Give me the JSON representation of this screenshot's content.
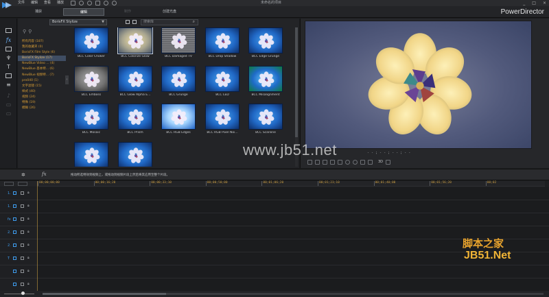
{
  "app": {
    "menu": [
      "文件",
      "编辑",
      "查看",
      "播放"
    ],
    "project_name": "未命名的项目",
    "window_controls": [
      "_",
      "□",
      "×"
    ],
    "brand": "PowerDirector",
    "modes": [
      "捕获",
      "编辑",
      "制作",
      "创建光盘"
    ]
  },
  "library": {
    "dropdown_value": "BorisFX Stylize",
    "search_placeholder": "搜索库",
    "categories": [
      "所有内容 (187)",
      "我的收藏夹 (0)",
      "BorisFX Film Style (6)",
      "BorisFX Stylize (17)",
      "NewBlue Video ... (4)",
      "NewBlue 基本特... (6)",
      "NewBlue 视频特... (7)",
      "pro040 (1)",
      "文字滤镜 (15)",
      "样式 (40)",
      "视频 (24)",
      "特殊 (19)",
      "模糊 (26)"
    ],
    "effects": [
      {
        "label": "BCC Color Choker",
        "style": "blue"
      },
      {
        "label": "BCC Colorize Glow",
        "style": "pale"
      },
      {
        "label": "BCC Damaged TV",
        "style": "glitch"
      },
      {
        "label": "BCC Drop Shadow",
        "style": "blue"
      },
      {
        "label": "BCC Edge Grunge",
        "style": "blue"
      },
      {
        "label": "BCC Emboss",
        "style": "gray"
      },
      {
        "label": "BCC Glow Alpha E...",
        "style": "blue"
      },
      {
        "label": "BCC Grunge",
        "style": "blue"
      },
      {
        "label": "BCC LED",
        "style": "blue"
      },
      {
        "label": "BCC Misalignment",
        "style": "green"
      },
      {
        "label": "BCC Mosaic",
        "style": "blue"
      },
      {
        "label": "BCC Prism",
        "style": "blue"
      },
      {
        "label": "BCC RGB Edges",
        "style": "bright"
      },
      {
        "label": "BCC RGB Pixel Noi...",
        "style": "blue"
      },
      {
        "label": "BCC Scanline",
        "style": "blue"
      },
      {
        "label": "",
        "style": "blue"
      },
      {
        "label": "",
        "style": "blue"
      }
    ]
  },
  "preview": {
    "timecode": "- - ; - - ; - - ; - -",
    "label_3d": "3D"
  },
  "edit_toolbar": {
    "hint": "拖动所选特效到视频上，或拖动到视频片段上然后将其应用至整个片段。"
  },
  "timeline": {
    "ticks": [
      "00;00;00;00",
      "00;00;16;20",
      "00;00;33;10",
      "00;00;50;00",
      "00;01;06;20",
      "00;01;23;10",
      "00;01;40;00",
      "00;01;56;20",
      "00;02"
    ],
    "tracks": [
      {
        "label": "1.",
        "kind": "video-track-icon"
      },
      {
        "label": "1.",
        "kind": "audio-track-icon"
      },
      {
        "label": "fx",
        "kind": "fx-track-icon"
      },
      {
        "label": "2.",
        "kind": "video-track-icon"
      },
      {
        "label": "2.",
        "kind": "audio-track-icon"
      },
      {
        "label": "T",
        "kind": "title-track-icon"
      },
      {
        "label": "",
        "kind": "voice-track-icon"
      },
      {
        "label": "",
        "kind": "music-track-icon"
      }
    ]
  },
  "watermarks": {
    "center": "www.jb51.net",
    "corner_cn": "脚本之家",
    "corner_en": "JB51.Net"
  },
  "colors": {
    "accent": "#3f9ff2",
    "category_text": "#d49a35",
    "timecode": "#c79b43"
  }
}
